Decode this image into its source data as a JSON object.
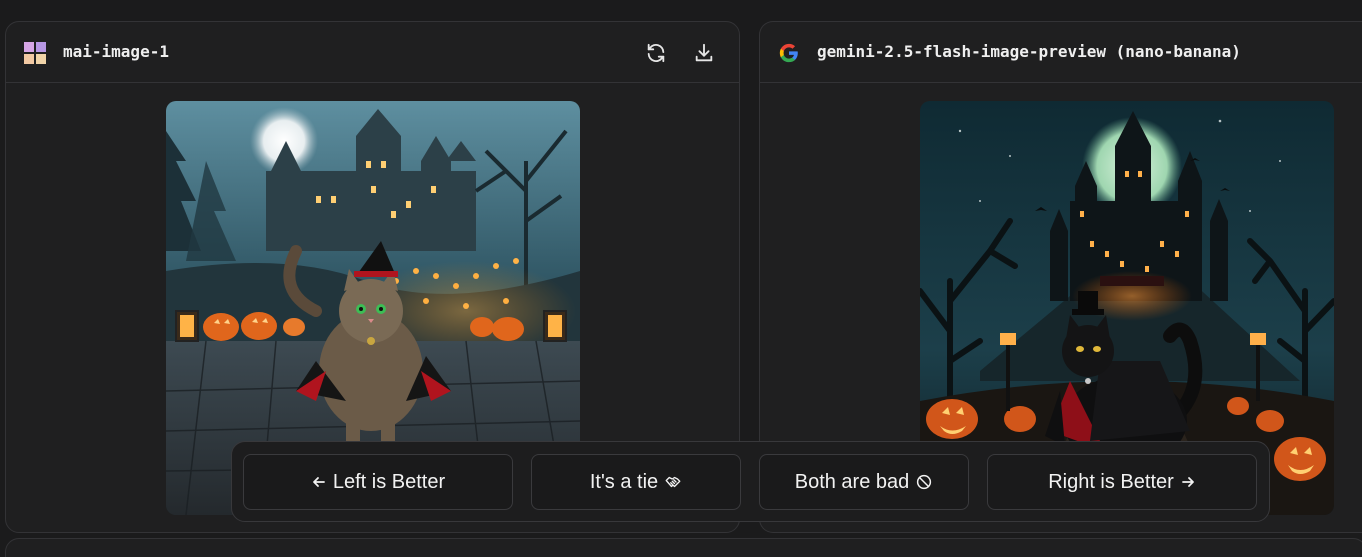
{
  "left_panel": {
    "model_name": "mai-image-1",
    "icons": {
      "model": "microsoft-logo-icon",
      "refresh": "refresh-icon",
      "download": "download-icon"
    }
  },
  "right_panel": {
    "model_name": "gemini-2.5-flash-image-preview (nano-banana)",
    "icons": {
      "model": "google-logo-icon"
    }
  },
  "vote_bar": {
    "left_better": "Left is Better",
    "tie": "It's a tie",
    "both_bad": "Both are bad",
    "right_better": "Right is Better",
    "icons": {
      "left_arrow": "arrow-left-icon",
      "tie": "handshake-icon",
      "both_bad": "prohibited-icon",
      "right_arrow": "arrow-right-icon"
    }
  },
  "colors": {
    "background": "#1b1b1c",
    "panel": "#1f1f20",
    "border": "#333336",
    "text": "#efefef"
  }
}
